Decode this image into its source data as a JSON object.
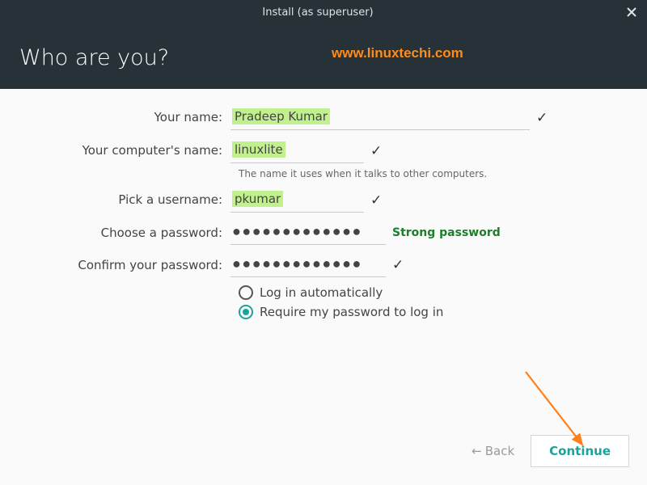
{
  "titlebar": {
    "title": "Install (as superuser)"
  },
  "header": {
    "heading": "Who are you?"
  },
  "watermark": "www.linuxtechi.com",
  "labels": {
    "name": "Your name:",
    "hostname": "Your computer's name:",
    "hostname_hint": "The name it uses when it talks to other computers.",
    "username": "Pick a username:",
    "password": "Choose a password:",
    "confirm": "Confirm your password:"
  },
  "values": {
    "name": "Pradeep Kumar",
    "hostname": "linuxlite",
    "username": "pkumar",
    "password_mask": "●●●●●●●●●●●●●",
    "confirm_mask": "●●●●●●●●●●●●●",
    "strength": "Strong password"
  },
  "login_options": {
    "auto": "Log in automatically",
    "require": "Require my password to log in",
    "selected": "require"
  },
  "buttons": {
    "back": "Back",
    "continue": "Continue"
  }
}
